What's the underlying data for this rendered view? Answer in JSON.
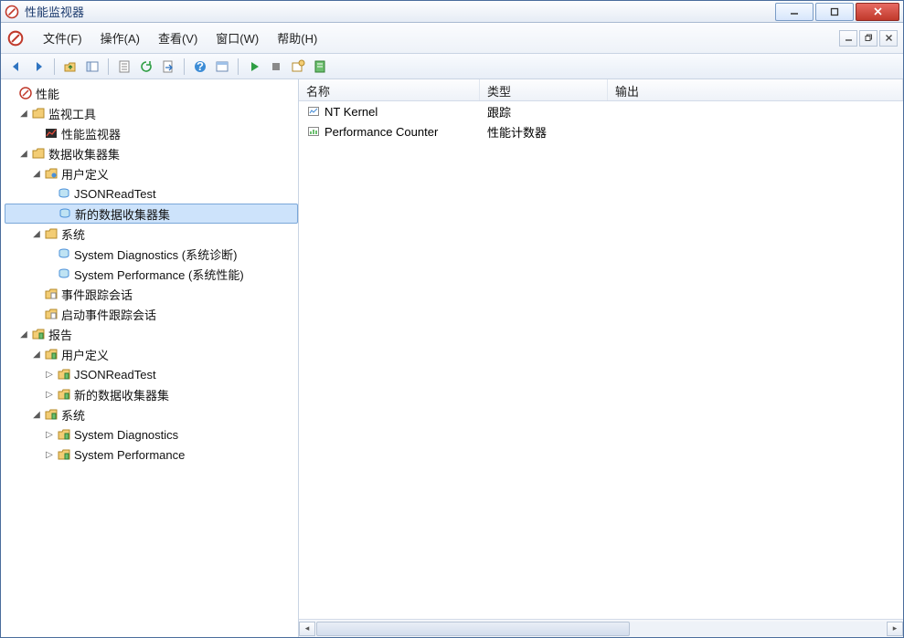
{
  "title": "性能监视器",
  "menu": {
    "file": "文件(F)",
    "action": "操作(A)",
    "view": "查看(V)",
    "window": "窗口(W)",
    "help": "帮助(H)"
  },
  "tree": {
    "root": "性能",
    "monitor_tools": "监视工具",
    "perf_monitor": "性能监视器",
    "data_collector_sets": "数据收集器集",
    "user_defined": "用户定义",
    "json_read_test": "JSONReadTest",
    "new_dcs": "新的数据收集器集",
    "system": "系统",
    "system_diag": "System Diagnostics (系统诊断)",
    "system_perf": "System Performance (系统性能)",
    "event_trace_sessions": "事件跟踪会话",
    "startup_event_trace": "启动事件跟踪会话",
    "reports": "报告",
    "r_user_defined": "用户定义",
    "r_json_read_test": "JSONReadTest",
    "r_new_dcs": "新的数据收集器集",
    "r_system": "系统",
    "r_system_diag": "System Diagnostics",
    "r_system_perf": "System Performance"
  },
  "list": {
    "columns": {
      "name": "名称",
      "type": "类型",
      "output": "输出"
    },
    "rows": [
      {
        "name": "NT Kernel",
        "type": "跟踪",
        "output": ""
      },
      {
        "name": "Performance Counter",
        "type": "性能计数器",
        "output": ""
      }
    ]
  }
}
